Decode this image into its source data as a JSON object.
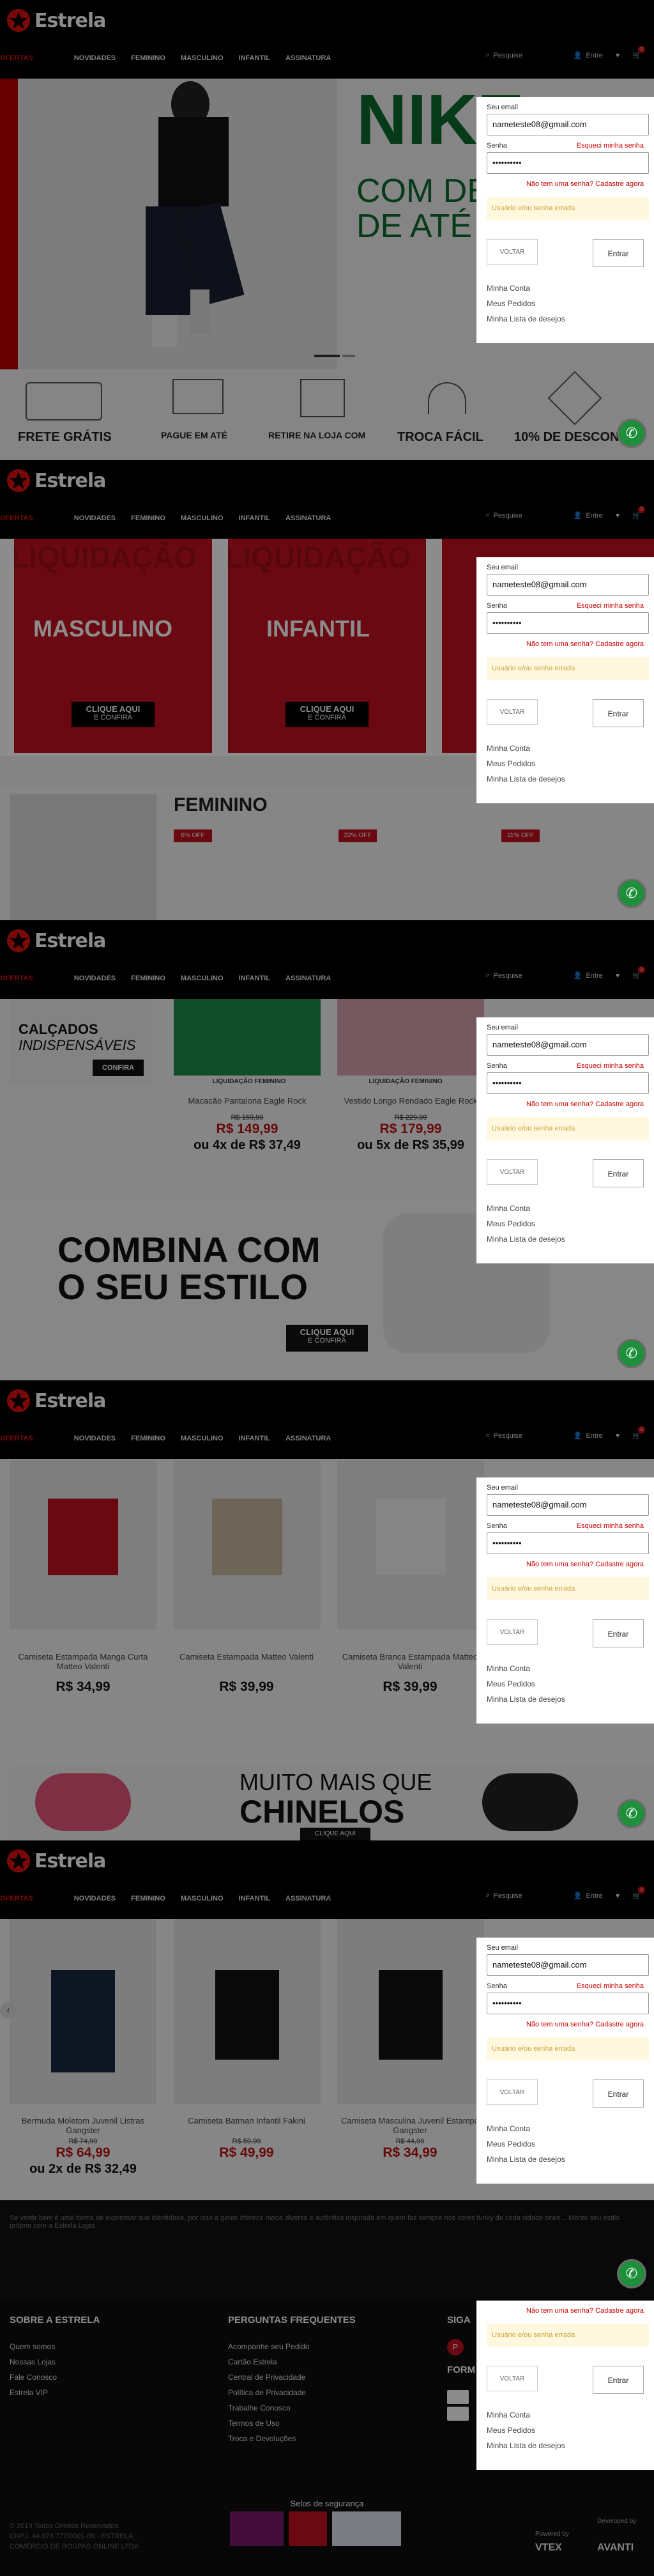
{
  "brand": {
    "name": "Estrela"
  },
  "nav": [
    "OFERTAS",
    "NOVIDADES",
    "FEMININO",
    "MASCULINO",
    "INFANTIL",
    "ASSINATURA"
  ],
  "tools": {
    "search": "Pesquise",
    "login": "Entre",
    "cart_count": "0"
  },
  "login": {
    "email_label": "Seu email",
    "email_value": "nameteste08@gmail.com",
    "pass_label": "Senha",
    "forgot": "Esqueci minha senha",
    "pass_value": "••••••••••",
    "signup": "Não tem uma senha? Cadastre agora",
    "error": "Usuário e/ou senha errada",
    "back": "VOLTAR",
    "enter": "Entrar",
    "links": [
      "Minha Conta",
      "Meus Pedidos",
      "Minha Lista de desejos"
    ]
  },
  "hero": {
    "words": [
      "NIKE",
      "COM DE",
      "DE ATÉ"
    ]
  },
  "benefits": [
    "FRETE GRÁTIS",
    "PAGUE EM ATÉ",
    "RETIRE NA LOJA COM",
    "TROCA FÁCIL",
    "10% DE DESCONTO"
  ],
  "liquidacao": {
    "bg": "LIQUIDAÇÃO",
    "cards": [
      "MASCULINO",
      "INFANTIL"
    ],
    "cta1": "CLIQUE AQUI",
    "cta2": "E CONFIRA"
  },
  "feminino": {
    "title": "FEMININO",
    "badges": [
      "6% OFF",
      "22% OFF",
      "11% OFF"
    ]
  },
  "panel3": {
    "calcados1": "CALÇADOS",
    "calcados2": "INDISPENSÁVEIS",
    "confira": "CONFIRA",
    "products": [
      {
        "tag": "LIQUIDAÇÃO FEMININO",
        "name": "Macacão Pantalona Eagle Rock",
        "old": "R$ 159,99",
        "price": "R$ 149,99",
        "inst": "ou 4x de R$ 37,49"
      },
      {
        "tag": "LIQUIDAÇÃO FEMININO",
        "name": "Vestido Longo Rendado Eagle Rock",
        "old": "R$ 229,99",
        "price": "R$ 179,99",
        "inst": "ou 5x de R$ 35,99"
      }
    ],
    "combina1": "COMBINA COM",
    "combina2": "O SEU ESTILO",
    "cta1": "CLIQUE AQUI",
    "cta2": "E CONFIRA"
  },
  "panel4": {
    "products": [
      {
        "name": "Camiseta Estampada Manga Curta Matteo Valenti",
        "price": "R$ 34,99"
      },
      {
        "name": "Camiseta Estampada Matteo Valenti",
        "price": "R$ 39,99"
      },
      {
        "name": "Camiseta Branca Estampada Matteo Valenti",
        "price": "R$ 39,99"
      }
    ],
    "banner1": "MUITO MAIS QUE",
    "banner2": "CHINELOS",
    "cta": "CLIQUE AQUI"
  },
  "panel5": {
    "products": [
      {
        "name": "Bermuda Moletom Juvenil Listras Gangster",
        "old": "R$ 74,99",
        "price": "R$ 64,99",
        "inst": "ou 2x de R$ 32,49"
      },
      {
        "name": "Camiseta Batman Infantil Fakini",
        "old": "R$ 59,99",
        "price": "R$ 49,99",
        "inst": ""
      },
      {
        "name": "Camiseta Masculina Juvenil Estampa Gangster",
        "old": "R$ 44,99",
        "price": "R$ 34,99",
        "inst": ""
      }
    ]
  },
  "footer": {
    "about": "Se vestir bem é uma forma de expressar sua identidade, por isso a gente oferece moda diversa e autêntica inspirada em quem faz sempre nos cores funky de cada cidade onde... Monte seu estilo próprio com a Estrela Lojas.",
    "col1_title": "SOBRE A ESTRELA",
    "col1": [
      "Quem somos",
      "Nossas Lojas",
      "Fale Conosco",
      "Estrela VIP"
    ],
    "col2_title": "PERGUNTAS FREQUENTES",
    "col2": [
      "Acompanhe seu Pedido",
      "Cartão Estrela",
      "Central de Privacidade",
      "Política de Privacidade",
      "Trabalhe Conosco",
      "Termos de Uso",
      "Troca e Devoluções"
    ],
    "col3_title": "SIGA",
    "col3b": "FORM",
    "security": "Selos de segurança",
    "copy1": "© 2019 Todos Direitos Reservados.",
    "copy2": "CNPJ: 44.978.777/0001-09 - ESTRELA",
    "copy3": "COMÉRCIO DE ROUPAS ONLINE LTDA",
    "powered": "Powered by",
    "powered_brand": "VTEX",
    "dev": "Developed by",
    "dev_brand": "AVANTI"
  }
}
